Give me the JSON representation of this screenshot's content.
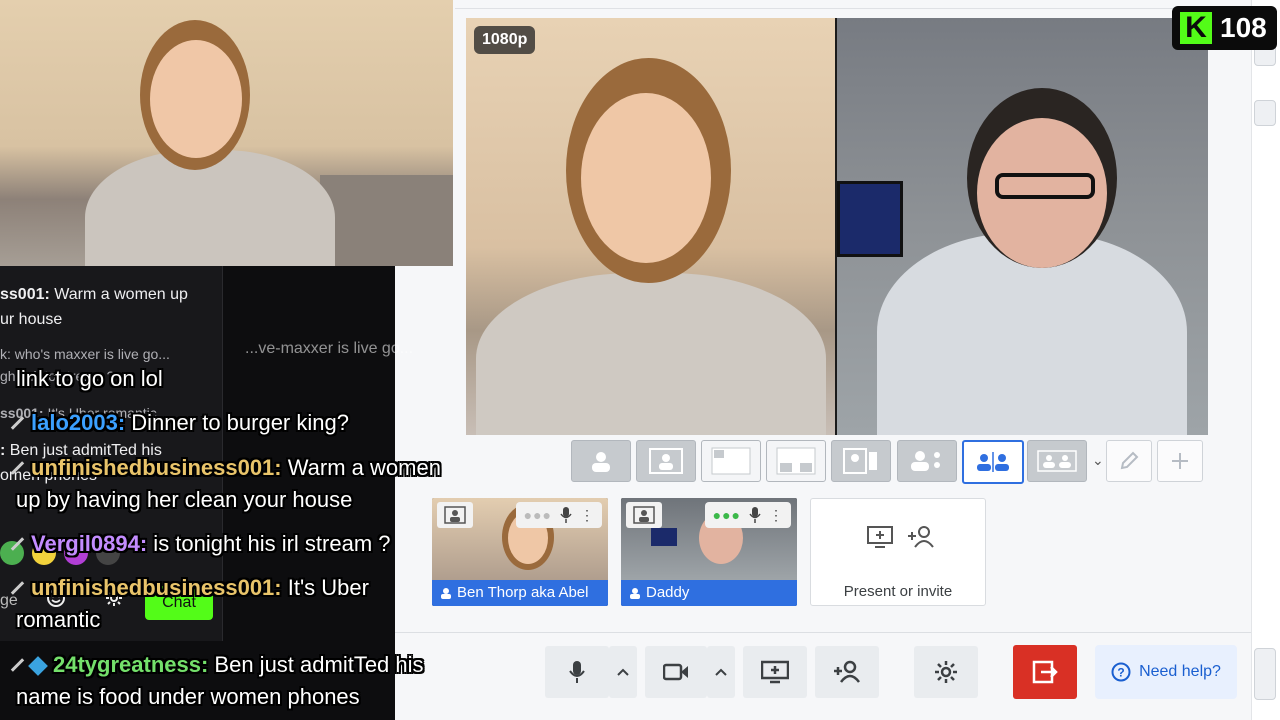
{
  "stage": {
    "resolution_badge": "1080p"
  },
  "viewers": {
    "count": "108"
  },
  "participants": [
    {
      "name": "Ben Thorp aka Abel"
    },
    {
      "name": "Daddy"
    }
  ],
  "present": {
    "label": "Present or invite"
  },
  "help": {
    "label": "Need help?"
  },
  "chat_panel": {
    "messages": [
      {
        "user": "ss001:",
        "text": " Warm a women up"
      },
      {
        "user": "",
        "text": "ur house"
      },
      {
        "user": "",
        "text": "k: who's maxxer is live go..."
      },
      {
        "user": "",
        "text": "gh link to stream ?"
      },
      {
        "user": "ss001:",
        "text": " It's Uber romantic"
      },
      {
        "user": ":",
        "text": " Ben just admitTed his"
      },
      {
        "user": "",
        "text": "omen phones"
      }
    ],
    "footer_text": "ge",
    "chat_button": "Chat"
  },
  "overlay_chat": [
    {
      "user": "",
      "text": "link to go on lol",
      "color": "#ffffff"
    },
    {
      "user": "lalo2003:",
      "text": " Dinner to burger king?",
      "color": "#3ba0ff"
    },
    {
      "user": "unfinishedbusiness001:",
      "text": " Warm a women",
      "color": "#e9c46a"
    },
    {
      "user": "",
      "text": "up by having her clean your house",
      "color": "#ffffff"
    },
    {
      "user": "Vergil0894:",
      "text": " is tonight his irl stream ?",
      "color": "#c38cff"
    },
    {
      "user": "unfinishedbusiness001:",
      "text": " It's Uber",
      "color": "#e9c46a"
    },
    {
      "user": "",
      "text": "romantic",
      "color": "#ffffff"
    },
    {
      "user": "24tygreatness:",
      "text": " Ben just admitTed his",
      "color": "#74e06b"
    },
    {
      "user": "",
      "text": "name is food under women phones",
      "color": "#ffffff"
    }
  ],
  "colors": {
    "accent": "#2f6fe0",
    "leave": "#d93025",
    "kick_green": "#53fc18"
  }
}
